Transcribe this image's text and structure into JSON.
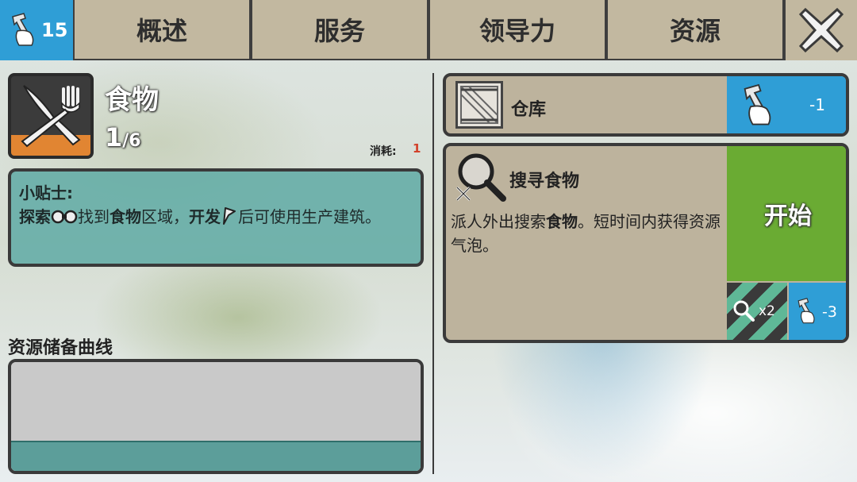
{
  "topbar": {
    "workers": "15",
    "tabs": [
      "概述",
      "服务",
      "领导力",
      "资源"
    ]
  },
  "resource": {
    "name": "食物",
    "count": "1",
    "capacity": "/6",
    "consume_label": "消耗:",
    "consume_value": "1"
  },
  "tips": {
    "title": "小贴士:",
    "explore": "探索",
    "find": "找到",
    "food": "食物",
    "area": "区域，",
    "develop": "开发",
    "rest": "后可使用生产建筑。"
  },
  "chart_section": {
    "title": "资源储备曲线"
  },
  "chart_data": {
    "type": "area",
    "fill_fraction": 0.27
  },
  "warehouse": {
    "label": "仓库",
    "cost": "-1"
  },
  "task": {
    "title": "搜寻食物",
    "desc_1": "派人外出搜索",
    "desc_food": "食物",
    "desc_2": "。短时间内获得资源气泡。",
    "start_label": "开始",
    "multiplier": "x2",
    "cost": "-3"
  },
  "colors": {
    "accent_blue": "#2f9ed6",
    "start_green": "#6aab33",
    "food_orange": "#e18532",
    "tips_teal": "#5faaa5"
  }
}
